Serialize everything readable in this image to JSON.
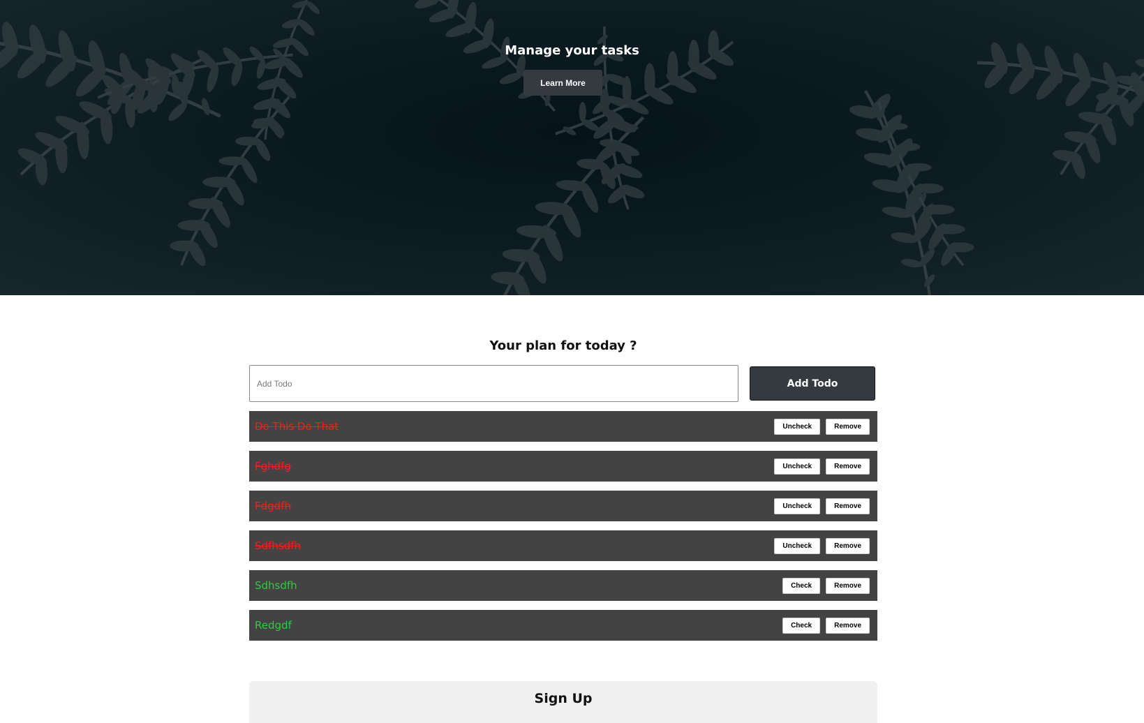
{
  "hero": {
    "title": "Manage your tasks",
    "learn_more_label": "Learn More"
  },
  "todo_section": {
    "title": "Your plan for today ?",
    "input_value": "",
    "input_placeholder": "Add Todo",
    "add_button_label": "Add Todo"
  },
  "todos": [
    {
      "text": "Do This Do That",
      "completed": true,
      "toggle_label": "Uncheck",
      "remove_label": "Remove"
    },
    {
      "text": "Fghdfg",
      "completed": true,
      "toggle_label": "Uncheck",
      "remove_label": "Remove"
    },
    {
      "text": "Fdgdfh",
      "completed": true,
      "toggle_label": "Uncheck",
      "remove_label": "Remove"
    },
    {
      "text": "Sdfhsdfh",
      "completed": true,
      "toggle_label": "Uncheck",
      "remove_label": "Remove"
    },
    {
      "text": "Sdhsdfh",
      "completed": false,
      "toggle_label": "Check",
      "remove_label": "Remove"
    },
    {
      "text": "Redgdf",
      "completed": false,
      "toggle_label": "Check",
      "remove_label": "Remove"
    }
  ],
  "signup": {
    "title": "Sign Up"
  },
  "colors": {
    "completed_text": "#ff1a1a",
    "pending_text": "#2ecc40",
    "row_background": "#434343",
    "button_dark": "#343a40"
  },
  "icons": {
    "hero_background": "fern-leaves-image"
  }
}
